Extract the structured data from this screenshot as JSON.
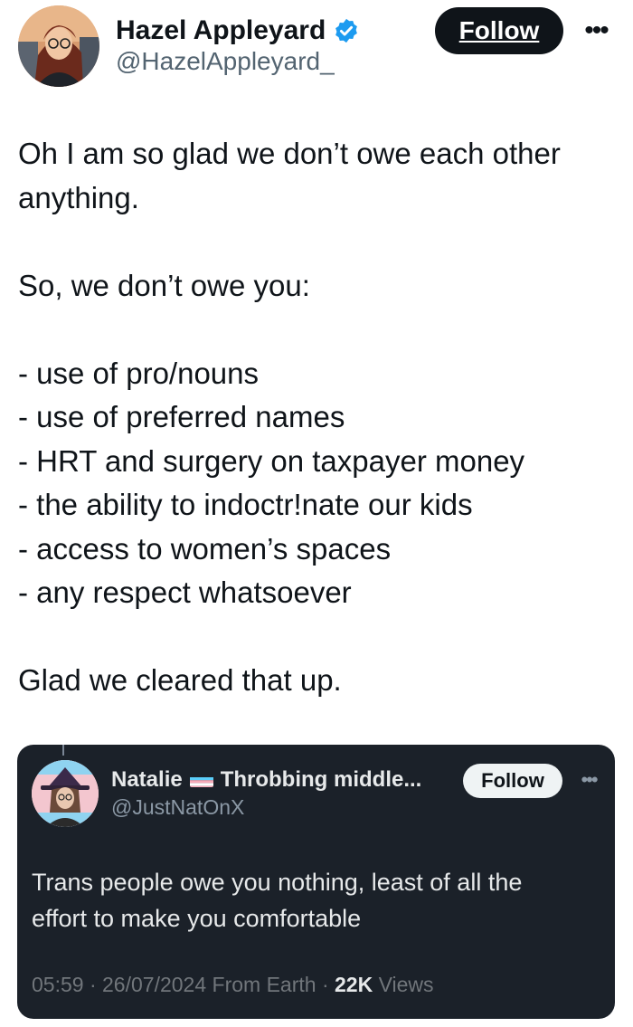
{
  "author": {
    "name": "Hazel Appleyard",
    "handle": "@HazelAppleyard_",
    "verified": true
  },
  "follow_label": "Follow",
  "more_label": "•••",
  "tweet": {
    "lines": [
      "Oh I am so glad we don’t owe each other",
      "anything.",
      "So, we don’t owe you:",
      "- use of pro/nouns",
      "- use of preferred names",
      "- HRT and surgery on taxpayer money",
      "- the ability to indoctr!nate our kids",
      "- access to women’s spaces",
      "- any respect whatsoever",
      "Glad we cleared that up."
    ]
  },
  "quote": {
    "name_prefix": "Natalie",
    "name_suffix": "Throbbing middle...",
    "handle": "@JustNatOnX",
    "follow_label": "Follow",
    "more_label": "•••",
    "text_lines": [
      "Trans people owe you nothing, least of all the",
      "effort to make you comfortable"
    ],
    "time": "05:59",
    "date": "26/07/2024",
    "source": "From Earth",
    "separator": "·",
    "views_count": "22K",
    "views_label": "Views"
  },
  "colors": {
    "follow_bg": "#0f1419",
    "verified": "#1d9bf0",
    "quote_bg": "#1b2129",
    "flag_blue": "#5bcefa",
    "flag_pink": "#f5a9b8",
    "flag_white": "#ffffff"
  },
  "icons": {
    "verified": "verified-badge-icon",
    "more": "more-dots-icon",
    "flag": "transgender-flag-emoji"
  }
}
